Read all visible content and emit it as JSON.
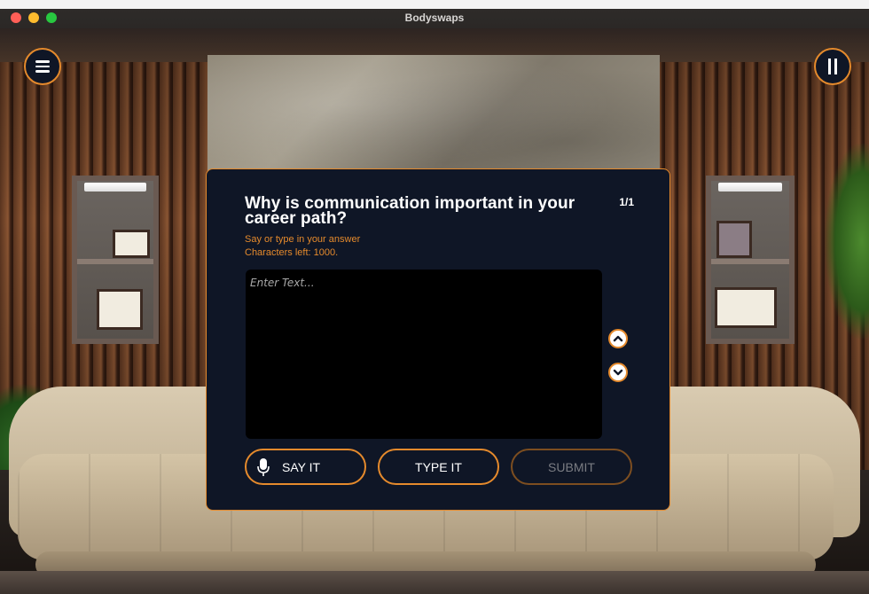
{
  "window": {
    "title": "Bodyswaps"
  },
  "hud": {
    "menu_icon": "hamburger-menu-icon",
    "pause_icon": "pause-icon"
  },
  "dialog": {
    "question": "Why is communication important in your career path?",
    "page_indicator": "1/1",
    "instruction": "Say or type in your answer",
    "characters_left": "Characters left: 1000.",
    "input": {
      "placeholder": "Enter Text...",
      "value": ""
    },
    "scroll_up_icon": "chevron-up-icon",
    "scroll_down_icon": "chevron-down-icon",
    "buttons": {
      "say_it": "SAY IT",
      "type_it": "TYPE IT",
      "submit": "SUBMIT"
    },
    "mic_icon": "microphone-icon"
  },
  "colors": {
    "accent": "#e58a2c",
    "panel_bg": "#0f1626",
    "disabled_text": "#7a7c82"
  }
}
